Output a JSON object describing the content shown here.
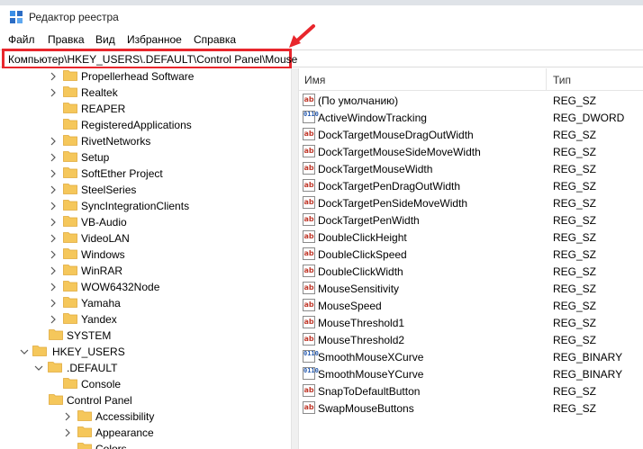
{
  "window": {
    "title": "Редактор реестра"
  },
  "menu": [
    "Файл",
    "Правка",
    "Вид",
    "Избранное",
    "Справка"
  ],
  "address": "Компьютер\\HKEY_USERS\\.DEFAULT\\Control Panel\\Mouse",
  "colors": {
    "highlight": "#e8262c",
    "folder": "#f5c75b",
    "folder_dark": "#e0a93a"
  },
  "tree": [
    {
      "label": "Propellerhead Software",
      "expander": "closed"
    },
    {
      "label": "Realtek",
      "expander": "closed"
    },
    {
      "label": "REAPER",
      "expander": "none"
    },
    {
      "label": "RegisteredApplications",
      "expander": "none"
    },
    {
      "label": "RivetNetworks",
      "expander": "closed"
    },
    {
      "label": "Setup",
      "expander": "closed"
    },
    {
      "label": "SoftEther Project",
      "expander": "closed"
    },
    {
      "label": "SteelSeries",
      "expander": "closed"
    },
    {
      "label": "SyncIntegrationClients",
      "expander": "closed"
    },
    {
      "label": "VB-Audio",
      "expander": "closed"
    },
    {
      "label": "VideoLAN",
      "expander": "closed"
    },
    {
      "label": "Windows",
      "expander": "closed"
    },
    {
      "label": "WinRAR",
      "expander": "closed"
    },
    {
      "label": "WOW6432Node",
      "expander": "closed"
    },
    {
      "label": "Yamaha",
      "expander": "closed"
    },
    {
      "label": "Yandex",
      "expander": "closed"
    },
    {
      "label": "SYSTEM",
      "expander": "closed"
    },
    {
      "label": "HKEY_USERS",
      "expander": "open"
    },
    {
      "label": ".DEFAULT",
      "expander": "open"
    },
    {
      "label": "Console",
      "expander": "none"
    },
    {
      "label": "Control Panel",
      "expander": "open"
    },
    {
      "label": "Accessibility",
      "expander": "closed"
    },
    {
      "label": "Appearance",
      "expander": "closed"
    },
    {
      "label": "Colors",
      "expander": "none"
    }
  ],
  "columns": {
    "name": "Имя",
    "type": "Тип"
  },
  "values": [
    {
      "name": "(По умолчанию)",
      "type": "REG_SZ",
      "kind": "string"
    },
    {
      "name": "ActiveWindowTracking",
      "type": "REG_DWORD",
      "kind": "binary"
    },
    {
      "name": "DockTargetMouseDragOutWidth",
      "type": "REG_SZ",
      "kind": "string"
    },
    {
      "name": "DockTargetMouseSideMoveWidth",
      "type": "REG_SZ",
      "kind": "string"
    },
    {
      "name": "DockTargetMouseWidth",
      "type": "REG_SZ",
      "kind": "string"
    },
    {
      "name": "DockTargetPenDragOutWidth",
      "type": "REG_SZ",
      "kind": "string"
    },
    {
      "name": "DockTargetPenSideMoveWidth",
      "type": "REG_SZ",
      "kind": "string"
    },
    {
      "name": "DockTargetPenWidth",
      "type": "REG_SZ",
      "kind": "string"
    },
    {
      "name": "DoubleClickHeight",
      "type": "REG_SZ",
      "kind": "string"
    },
    {
      "name": "DoubleClickSpeed",
      "type": "REG_SZ",
      "kind": "string"
    },
    {
      "name": "DoubleClickWidth",
      "type": "REG_SZ",
      "kind": "string"
    },
    {
      "name": "MouseSensitivity",
      "type": "REG_SZ",
      "kind": "string"
    },
    {
      "name": "MouseSpeed",
      "type": "REG_SZ",
      "kind": "string"
    },
    {
      "name": "MouseThreshold1",
      "type": "REG_SZ",
      "kind": "string"
    },
    {
      "name": "MouseThreshold2",
      "type": "REG_SZ",
      "kind": "string"
    },
    {
      "name": "SmoothMouseXCurve",
      "type": "REG_BINARY",
      "kind": "binary"
    },
    {
      "name": "SmoothMouseYCurve",
      "type": "REG_BINARY",
      "kind": "binary"
    },
    {
      "name": "SnapToDefaultButton",
      "type": "REG_SZ",
      "kind": "string"
    },
    {
      "name": "SwapMouseButtons",
      "type": "REG_SZ",
      "kind": "string"
    }
  ]
}
